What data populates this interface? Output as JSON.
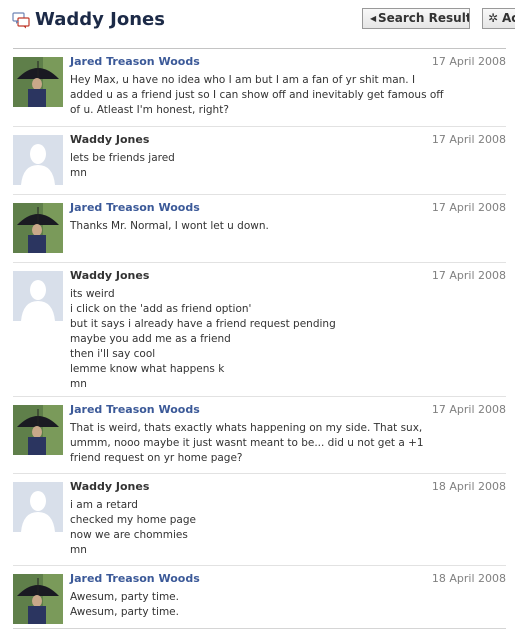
{
  "header": {
    "title": "Waddy Jones",
    "search_results_label": "Search Results",
    "actions_label": "Actions"
  },
  "messages": [
    {
      "author": "Jared Treason Woods",
      "date": "17 April 2008",
      "lines": [
        "Hey Max, u have no idea who I am but I am a fan of yr shit man. I",
        "added u as a friend just so I can show off and inevitably get famous off",
        "of u. Atleast I'm honest, right?"
      ]
    },
    {
      "author": "Waddy Jones",
      "date": "17 April 2008",
      "lines": [
        "lets be friends jared",
        "mn"
      ]
    },
    {
      "author": "Jared Treason Woods",
      "date": "17 April 2008",
      "lines": [
        "Thanks Mr. Normal, I wont let u down."
      ]
    },
    {
      "author": "Waddy Jones",
      "date": "17 April 2008",
      "lines": [
        "its weird",
        "i click on the 'add as friend option'",
        "but it says i already have a friend request pending",
        "maybe you add me as a friend",
        "then i'll say cool",
        "lemme know what happens k",
        "mn"
      ]
    },
    {
      "author": "Jared Treason Woods",
      "date": "17 April 2008",
      "lines": [
        "That is weird, thats exactly whats happening on my side. That sux,",
        "ummm, nooo maybe it just wasnt meant to be... did u not get a +1",
        "friend request on yr home page?"
      ]
    },
    {
      "author": "Waddy Jones",
      "date": "18 April 2008",
      "lines": [
        "i am a retard",
        "checked my home page",
        "now we are chommies",
        "mn"
      ]
    },
    {
      "author": "Jared Treason Woods",
      "date": "18 April 2008",
      "lines": [
        "Awesum, party time.",
        "Awesum, party time."
      ]
    }
  ],
  "colors": {
    "title": "#1c2a47",
    "link": "#3b5998",
    "date": "#808080",
    "divider": "#e2e2e2",
    "silhouette_bg": "#d8dfea"
  }
}
